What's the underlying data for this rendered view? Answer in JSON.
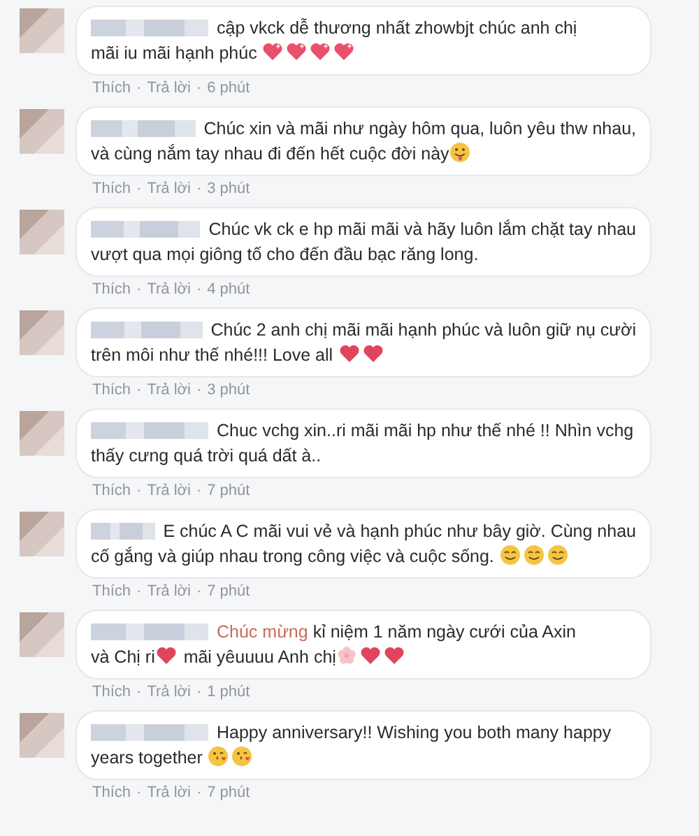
{
  "separator": "·",
  "comments": [
    {
      "lines": [
        [
          {
            "kind": "text",
            "text": "cập vkck dễ thương nhất zhowbjt chúc anh chị"
          }
        ],
        [
          {
            "kind": "text",
            "text": "mãi iu mãi hạnh phúc "
          },
          {
            "kind": "sparkle_heart"
          },
          {
            "kind": "sparkle_heart"
          },
          {
            "kind": "sparkle_heart"
          },
          {
            "kind": "sparkle_heart"
          }
        ]
      ],
      "like": "Thích",
      "reply": "Trả lời",
      "time": "6 phút"
    },
    {
      "lines": [
        [
          {
            "kind": "text",
            "text": "Chúc xin và mãi như ngày hôm qua, luôn yêu thw nhau,"
          }
        ],
        [
          {
            "kind": "text",
            "text": "và cùng nắm tay nhau đi đến hết cuộc đời này"
          },
          {
            "kind": "tongue_face"
          }
        ]
      ],
      "like": "Thích",
      "reply": "Trả lời",
      "time": "3 phút"
    },
    {
      "lines": [
        [
          {
            "kind": "text",
            "text": "Chúc vk ck e hp mãi mãi và hãy luôn lắm chặt tay nhau"
          }
        ],
        [
          {
            "kind": "text",
            "text": "vượt qua mọi giông tố cho đến đầu bạc răng long."
          }
        ]
      ],
      "like": "Thích",
      "reply": "Trả lời",
      "time": "4 phút"
    },
    {
      "lines": [
        [
          {
            "kind": "text",
            "text": "Chúc 2 anh chị mãi mãi hạnh phúc và luôn giữ nụ cười"
          }
        ],
        [
          {
            "kind": "text",
            "text": "trên môi như thế nhé!!! Love all "
          },
          {
            "kind": "heart"
          },
          {
            "kind": "heart"
          }
        ]
      ],
      "like": "Thích",
      "reply": "Trả lời",
      "time": "3 phút"
    },
    {
      "lines": [
        [
          {
            "kind": "text",
            "text": "Chuc vchg xin..ri mãi mãi hp như thế nhé !! Nhìn vchg"
          }
        ],
        [
          {
            "kind": "text",
            "text": "thấy cưng quá trời quá dất à.."
          }
        ]
      ],
      "like": "Thích",
      "reply": "Trả lời",
      "time": "7 phút"
    },
    {
      "lines": [
        [
          {
            "kind": "text",
            "text": "E chúc A C mãi vui vẻ và hạnh phúc như bây giờ. Cùng nhau"
          }
        ],
        [
          {
            "kind": "text",
            "text": "cố gắng và giúp nhau trong công việc và cuộc sống. "
          },
          {
            "kind": "smile_face"
          },
          {
            "kind": "smile_face"
          },
          {
            "kind": "smile_face"
          }
        ]
      ],
      "like": "Thích",
      "reply": "Trả lời",
      "time": "7 phút"
    },
    {
      "lines": [
        [
          {
            "kind": "tag",
            "text": "Chúc mừng"
          },
          {
            "kind": "text",
            "text": " kỉ niệm 1 năm ngày cưới của Axin"
          }
        ],
        [
          {
            "kind": "text",
            "text": "và Chị ri"
          },
          {
            "kind": "heart"
          },
          {
            "kind": "text",
            "text": " mãi yêuuuu Anh chị"
          },
          {
            "kind": "blossom"
          },
          {
            "kind": "heart"
          },
          {
            "kind": "heart"
          }
        ]
      ],
      "like": "Thích",
      "reply": "Trả lời",
      "time": "1 phút"
    },
    {
      "lines": [
        [
          {
            "kind": "text",
            "text": "Happy anniversary!! Wishing you both many happy"
          }
        ],
        [
          {
            "kind": "text",
            "text": "years together "
          },
          {
            "kind": "kiss_face"
          },
          {
            "kind": "kiss_face"
          }
        ]
      ],
      "like": "Thích",
      "reply": "Trả lời",
      "time": "7 phút"
    }
  ]
}
